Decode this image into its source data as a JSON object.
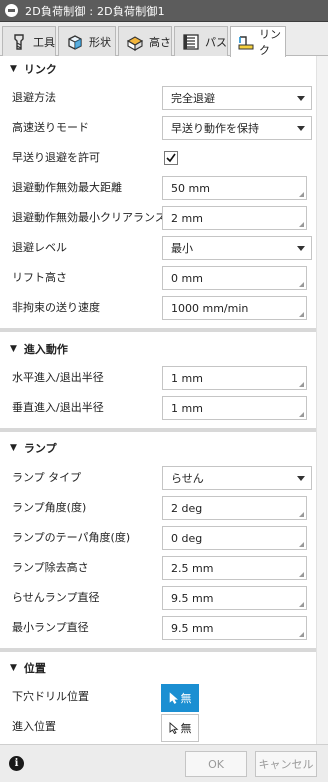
{
  "window": {
    "title": "2D負荷制御 : 2D負荷制御1"
  },
  "tabs": [
    {
      "label": "工具",
      "icon": "tool-icon"
    },
    {
      "label": "形状",
      "icon": "geometry-icon"
    },
    {
      "label": "高さ",
      "icon": "heights-icon"
    },
    {
      "label": "パス",
      "icon": "passes-icon"
    },
    {
      "label": "リンク",
      "icon": "linking-icon"
    }
  ],
  "sections": {
    "link": {
      "title": "リンク",
      "rows": [
        {
          "label": "退避方法",
          "value": "完全退避",
          "kind": "dropdown"
        },
        {
          "label": "高速送りモード",
          "value": "早送り動作を保持",
          "kind": "dropdown"
        },
        {
          "label": "早送り退避を許可",
          "checked": true,
          "kind": "checkbox"
        },
        {
          "label": "退避動作無効最大距離",
          "value": "50 mm",
          "kind": "input"
        },
        {
          "label": "退避動作無効最小クリアランス",
          "value": "2 mm",
          "kind": "input"
        },
        {
          "label": "退避レベル",
          "value": "最小",
          "kind": "dropdown"
        },
        {
          "label": "リフト高さ",
          "value": "0 mm",
          "kind": "input"
        },
        {
          "label": "非拘束の送り速度",
          "value": "1000 mm/min",
          "kind": "input"
        }
      ]
    },
    "lead": {
      "title": "進入動作",
      "rows": [
        {
          "label": "水平進入/退出半径",
          "value": "1 mm"
        },
        {
          "label": "垂直進入/退出半径",
          "value": "1 mm"
        }
      ]
    },
    "ramp": {
      "title": "ランプ",
      "rows": [
        {
          "label": "ランプ タイプ",
          "value": "らせん",
          "kind": "dropdown"
        },
        {
          "label": "ランプ角度(度)",
          "value": "2 deg",
          "kind": "input"
        },
        {
          "label": "ランプのテーパ角度(度)",
          "value": "0 deg",
          "kind": "input"
        },
        {
          "label": "ランプ除去高さ",
          "value": "2.5 mm",
          "kind": "input"
        },
        {
          "label": "らせんランプ直径",
          "value": "9.5 mm",
          "kind": "input"
        },
        {
          "label": "最小ランプ直径",
          "value": "9.5 mm",
          "kind": "input"
        }
      ]
    },
    "position": {
      "title": "位置",
      "rows": [
        {
          "label": "下穴ドリル位置",
          "value": "無",
          "active": true
        },
        {
          "label": "進入位置",
          "value": "無",
          "active": false
        }
      ]
    }
  },
  "footer": {
    "ok": "OK",
    "cancel": "キャンセル",
    "info_icon": "info-icon"
  },
  "colors": {
    "accent": "#1b8fd2",
    "titlebar": "#5c5c5c"
  }
}
